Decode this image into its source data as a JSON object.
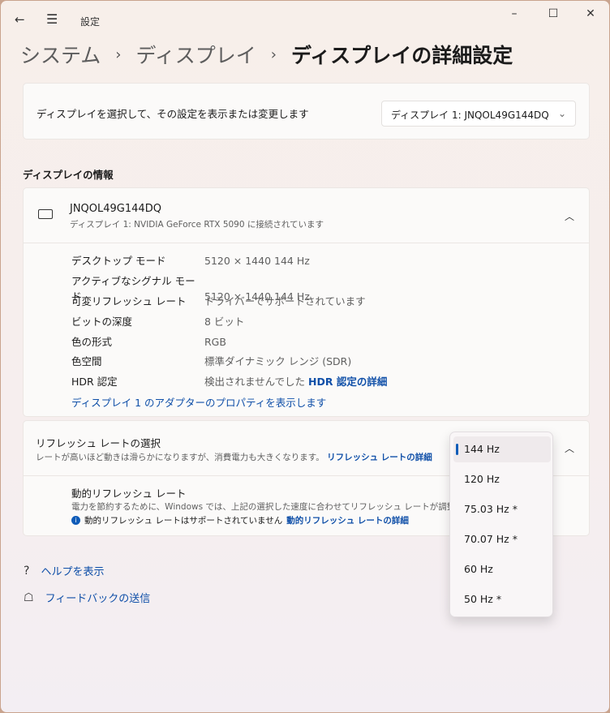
{
  "app": {
    "title": "設定"
  },
  "breadcrumb": [
    "システム",
    "ディスプレイ",
    "ディスプレイの詳細設定"
  ],
  "select_display": {
    "label": "ディスプレイを選択して、その設定を表示または変更します",
    "value": "ディスプレイ 1: JNQOL49G144DQ"
  },
  "section_title": "ディスプレイの情報",
  "display": {
    "name": "JNQOL49G144DQ",
    "subtitle": "ディスプレイ 1: NVIDIA GeForce RTX 5090 に接続されています",
    "rows": [
      {
        "k": "デスクトップ モード",
        "v": "5120 × 1440 144 Hz"
      },
      {
        "k": "アクティブなシグナル モード",
        "v": "5120 × 1440 144 Hz"
      },
      {
        "k": "可変リフレッシュ レート",
        "v": "ドライバーでサポートされています"
      },
      {
        "k": "ビットの深度",
        "v": "8 ビット"
      },
      {
        "k": "色の形式",
        "v": "RGB"
      },
      {
        "k": "色空間",
        "v": "標準ダイナミック レンジ (SDR)"
      },
      {
        "k": "HDR 認定",
        "v": "検出されませんでした",
        "link": "HDR 認定の詳細"
      }
    ],
    "adapter_link": "ディスプレイ 1 のアダプターのプロパティを表示します"
  },
  "refresh": {
    "title": "リフレッシュ レートの選択",
    "desc": "レートが高いほど動きは滑らかになりますが、消費電力も大きくなります。",
    "link": "リフレッシュ レートの詳細",
    "dynamic_title": "動的リフレッシュ レート",
    "dynamic_desc": "電力を節約するために、Windows では、上記の選択した速度に合わせてリフレッシュ レートが調整され",
    "dynamic_info": "動的リフレッシュ レートはサポートされていません",
    "dynamic_link": "動的リフレッシュ レートの詳細",
    "options": [
      "144 Hz",
      "120 Hz",
      "75.03 Hz *",
      "70.07 Hz *",
      "60 Hz",
      "50 Hz *"
    ],
    "selected": "144 Hz"
  },
  "footer": {
    "help": "ヘルプを表示",
    "feedback": "フィードバックの送信"
  }
}
